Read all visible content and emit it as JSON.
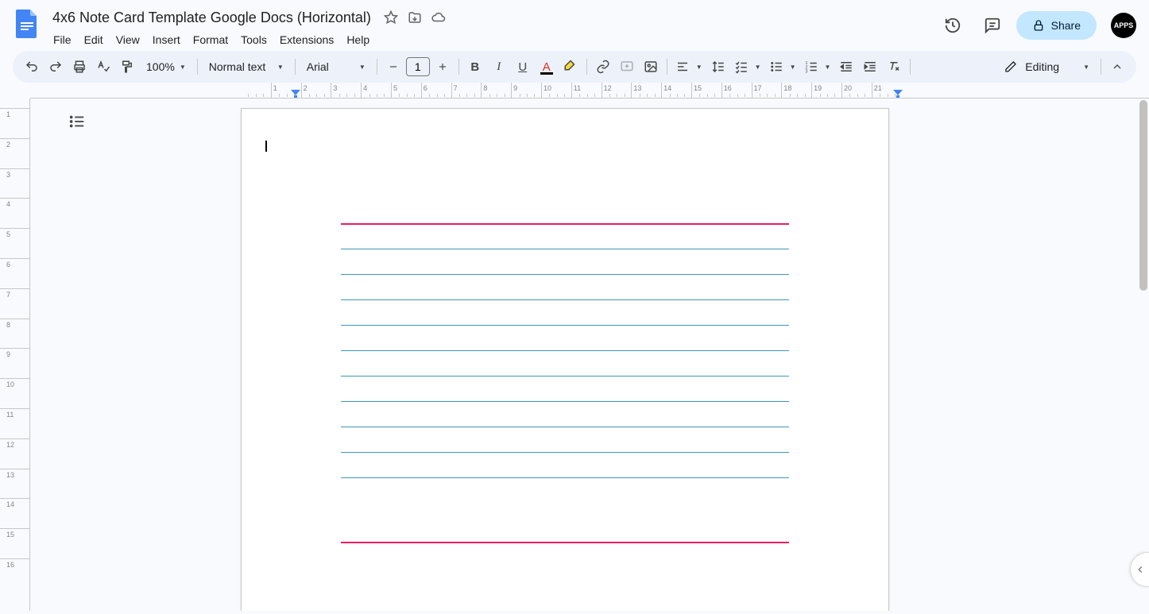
{
  "header": {
    "title": "4x6 Note Card Template Google Docs (Horizontal)",
    "menu": {
      "file": "File",
      "edit": "Edit",
      "view": "View",
      "insert": "Insert",
      "format": "Format",
      "tools": "Tools",
      "extensions": "Extensions",
      "help": "Help"
    },
    "share_label": "Share",
    "avatar_text": "APPS"
  },
  "toolbar": {
    "zoom": "100%",
    "style": "Normal text",
    "font": "Arial",
    "font_size": "1",
    "editing_mode": "Editing"
  },
  "ruler": {
    "h_labels": [
      "1",
      "2",
      "3",
      "4",
      "5",
      "6",
      "7",
      "8",
      "9",
      "10",
      "11",
      "12",
      "13",
      "14",
      "15",
      "16",
      "17",
      "18",
      "19",
      "20",
      "21"
    ],
    "v_labels": [
      "1",
      "2",
      "3",
      "4",
      "5",
      "6",
      "7",
      "8",
      "9",
      "10",
      "11",
      "12",
      "13",
      "14",
      "15",
      "16"
    ]
  },
  "document": {
    "colors": {
      "pink": "#e91e63",
      "blue": "#3d99b5"
    },
    "blue_lines_count": 10
  }
}
